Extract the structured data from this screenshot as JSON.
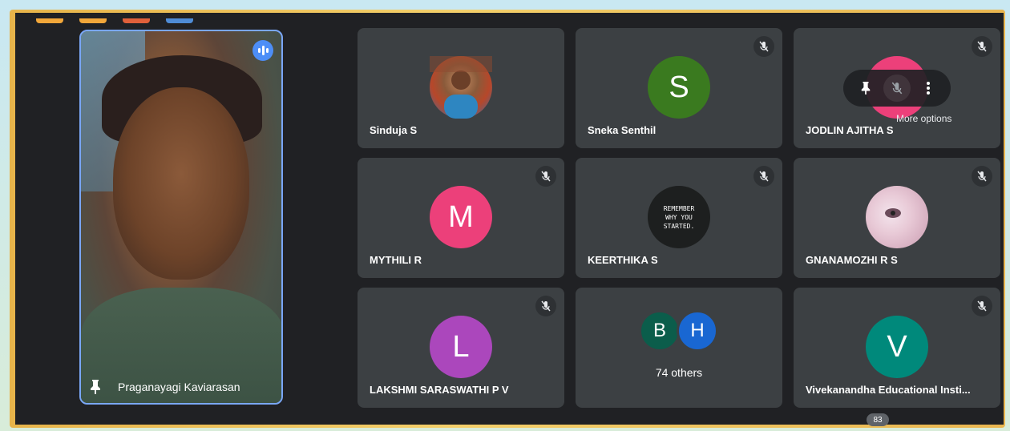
{
  "speaker": {
    "name": "Praganayagi Kaviarasan",
    "state": "speaking",
    "pinned": true
  },
  "tiles": [
    {
      "name": "Sinduja S",
      "avatar": "photo",
      "muted": false
    },
    {
      "name": "Sneka Senthil",
      "avatar": "S",
      "color": "#3a7a1f",
      "muted": true
    },
    {
      "name": "JODLIN AJITHA S",
      "avatar": "photo",
      "muted": true,
      "hover_tooltip": "More options"
    },
    {
      "name": "MYTHILI R",
      "avatar": "M",
      "color": "#ec407a",
      "muted": true
    },
    {
      "name": "KEERTHIKA S",
      "avatar": "photo",
      "photo_text": [
        "REMEMBER",
        "WHY YOU",
        "STARTED."
      ],
      "muted": true
    },
    {
      "name": "GNANAMOZHI R S",
      "avatar": "photo",
      "muted": true
    },
    {
      "name": "LAKSHMI SARASWATHI P V",
      "avatar": "L",
      "color": "#ab47bc",
      "muted": true
    },
    {
      "name": "74 others",
      "avatars": [
        "B",
        "H"
      ],
      "colors": [
        "#0b5d4b",
        "#1967d2"
      ]
    },
    {
      "name": "Vivekanandha Educational Insti...",
      "avatar": "V",
      "color": "#00897b",
      "muted": true
    }
  ],
  "participant_count": "83",
  "colors": {
    "stage": "#202124",
    "tile": "#3c4043",
    "speaking_border": "#7aa7f7",
    "frame_gold": "#f3cf6a"
  }
}
